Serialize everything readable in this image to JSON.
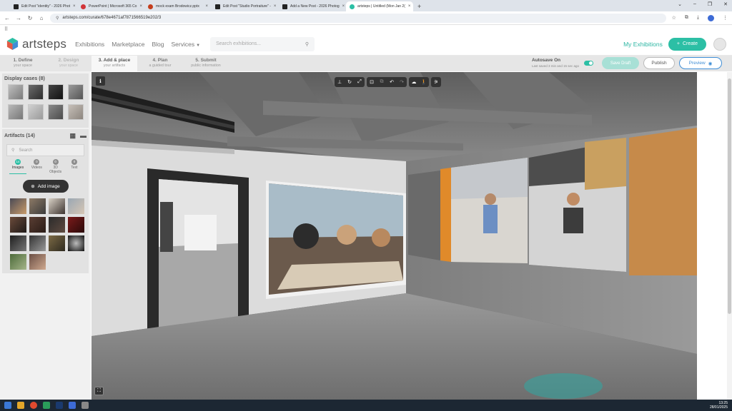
{
  "browser": {
    "tabs": [
      {
        "title": "Edit Post \"identity\" - 2026 Phot",
        "active": false
      },
      {
        "title": "PowerPoint | Microsoft 365 Co",
        "active": false
      },
      {
        "title": "mock exam Brodowicz.pptx",
        "active": false
      },
      {
        "title": "Edit Post \"Studio Portraiture\" -",
        "active": false
      },
      {
        "title": "Add a New Post - 2026 Photog",
        "active": false
      },
      {
        "title": "artsteps | Untitled (Mon Jan 2(",
        "active": true
      }
    ],
    "new_tab": "+",
    "url": "artsteps.com/curate/678e4671af7871566519e202/3"
  },
  "header": {
    "logo_text": "artsteps",
    "nav": [
      "Exhibitions",
      "Marketplace",
      "Blog",
      "Services"
    ],
    "search_placeholder": "Search exhibitions...",
    "my_exhibitions": "My Exhibitions",
    "create_label": "Create"
  },
  "steps": [
    {
      "title": "1. Define",
      "sub": "your space",
      "state": "done"
    },
    {
      "title": "2. Design",
      "sub": "your space",
      "state": "dim"
    },
    {
      "title": "3. Add & place",
      "sub": "your artifacts",
      "state": "active"
    },
    {
      "title": "4. Plan",
      "sub": "a guided tour",
      "state": "normal"
    },
    {
      "title": "5. Submit",
      "sub": "public information",
      "state": "normal"
    }
  ],
  "autosave": {
    "label": "Autosave On",
    "last_saved": "Last saved 3 min and 15 sec ago"
  },
  "actions": {
    "save_draft": "Save Draft",
    "publish": "Publish",
    "preview": "Preview"
  },
  "display_cases": {
    "title": "Display cases (8)"
  },
  "artifacts": {
    "title": "Artifacts (14)",
    "search_placeholder": "Search",
    "tabs": [
      {
        "label": "Images",
        "count": "14"
      },
      {
        "label": "Videos",
        "count": "0"
      },
      {
        "label": "3D Objects",
        "count": "0"
      },
      {
        "label": "Text",
        "count": "0"
      }
    ],
    "add_image": "Add image"
  },
  "taskbar": {
    "time": "13:25",
    "date": "28/01/2025"
  }
}
